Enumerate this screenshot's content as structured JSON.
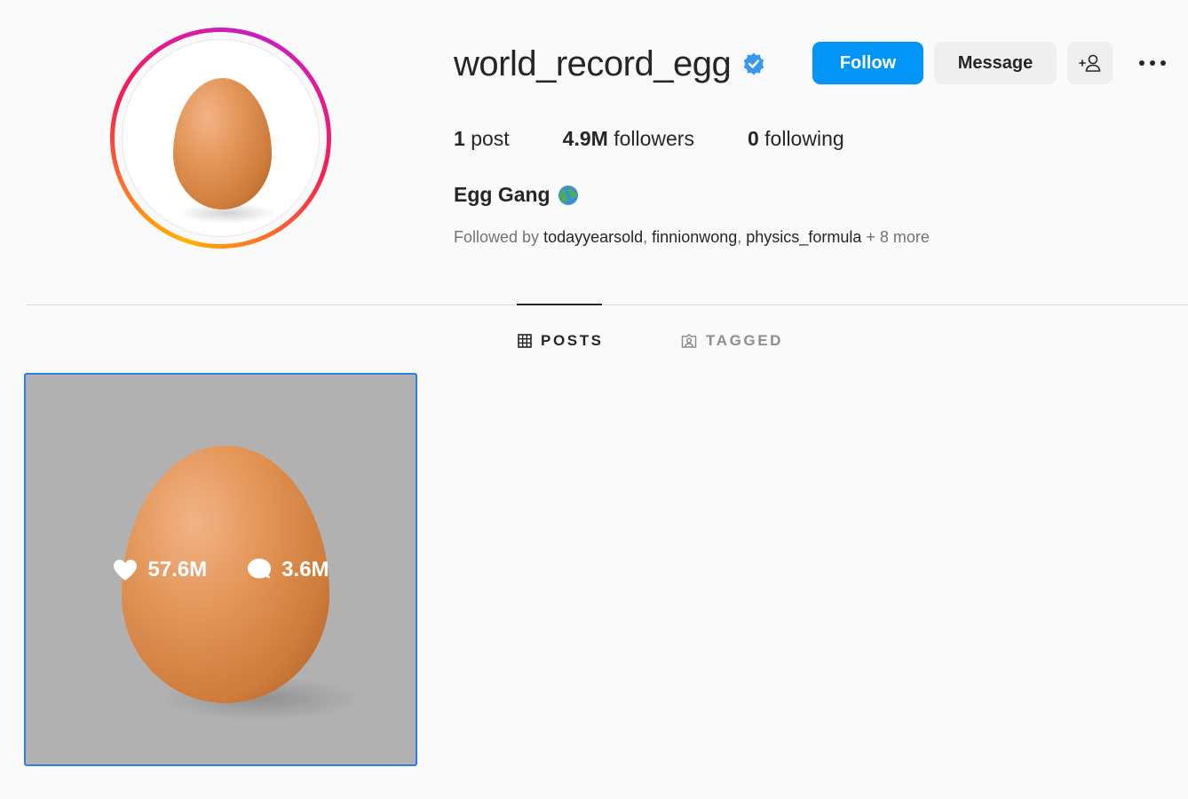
{
  "profile": {
    "username": "world_record_egg",
    "verified_icon": "verified-badge-icon",
    "full_name": "Egg Gang",
    "name_emoji": "globe-icon",
    "stats": {
      "posts_count": "1",
      "posts_label": "post",
      "followers_count": "4.9M",
      "followers_label": "followers",
      "following_count": "0",
      "following_label": "following"
    },
    "followed_by": {
      "prefix": "Followed by",
      "accounts": [
        "todayyearsold",
        "finnionwong",
        "physics_formula"
      ],
      "separator": ",",
      "more": "+ 8 more"
    }
  },
  "actions": {
    "follow_label": "Follow",
    "message_label": "Message",
    "suggest_icon": "add-person-icon",
    "more_icon": "more-options-icon"
  },
  "tabs": [
    {
      "label": "POSTS",
      "icon": "grid-icon",
      "active": true
    },
    {
      "label": "TAGGED",
      "icon": "tagged-icon",
      "active": false
    }
  ],
  "posts": [
    {
      "likes": "57.6M",
      "comments": "3.6M"
    }
  ],
  "colors": {
    "accent": "#0095f6",
    "verified": "#3897f0",
    "background": "#fafafa",
    "selection_border": "#2d7fe6"
  }
}
